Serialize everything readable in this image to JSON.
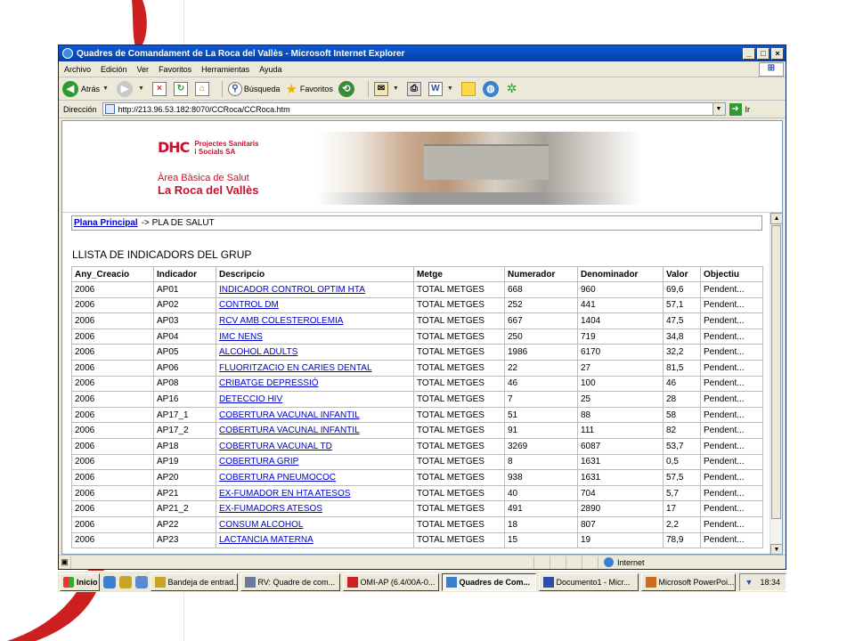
{
  "window": {
    "title": "Quadres de Comandament de La Roca del Vallès - Microsoft Internet Explorer",
    "buttons": {
      "minimize": "_",
      "maximize": "□",
      "close": "×"
    }
  },
  "menu": [
    "Archivo",
    "Edición",
    "Ver",
    "Favoritos",
    "Herramientas",
    "Ayuda"
  ],
  "toolbar": {
    "back": "Atrás",
    "search": "Búsqueda",
    "favorites": "Favoritos"
  },
  "address": {
    "label": "Dirección",
    "url": "http://213.96.53.182:8070/CCRoca/CCRoca.htm",
    "go": "Ir"
  },
  "banner": {
    "logo_mark": "DHC",
    "logo_line1": "Projectes Sanitaris",
    "logo_line2": "i Socials SA",
    "area_line1": "Àrea Bàsica de Salut",
    "area_line2": "La Roca del Vallès"
  },
  "breadcrumb": {
    "link": "Plana Principal",
    "rest": "-> PLA DE SALUT"
  },
  "list_title": "LLISTA DE INDICADORS DEL GRUP",
  "table": {
    "headers": [
      "Any_Creacio",
      "Indicador",
      "Descripcio",
      "Metge",
      "Numerador",
      "Denominador",
      "Valor",
      "Objectiu"
    ],
    "rows": [
      [
        "2006",
        "AP01",
        "INDICADOR CONTROL OPTIM HTA",
        "TOTAL METGES",
        "668",
        "960",
        "69,6",
        "Pendent..."
      ],
      [
        "2006",
        "AP02",
        "CONTROL DM",
        "TOTAL METGES",
        "252",
        "441",
        "57,1",
        "Pendent..."
      ],
      [
        "2006",
        "AP03",
        "RCV AMB COLESTEROLEMIA",
        "TOTAL METGES",
        "667",
        "1404",
        "47,5",
        "Pendent..."
      ],
      [
        "2006",
        "AP04",
        "IMC NENS",
        "TOTAL METGES",
        "250",
        "719",
        "34,8",
        "Pendent..."
      ],
      [
        "2006",
        "AP05",
        "ALCOHOL ADULTS",
        "TOTAL METGES",
        "1986",
        "6170",
        "32,2",
        "Pendent..."
      ],
      [
        "2006",
        "AP06",
        "FLUORITZACIO EN CARIES DENTAL",
        "TOTAL METGES",
        "22",
        "27",
        "81,5",
        "Pendent..."
      ],
      [
        "2006",
        "AP08",
        "CRIBATGE DEPRESSIÓ",
        "TOTAL METGES",
        "46",
        "100",
        "46",
        "Pendent..."
      ],
      [
        "2006",
        "AP16",
        "DETECCIO HIV",
        "TOTAL METGES",
        "7",
        "25",
        "28",
        "Pendent..."
      ],
      [
        "2006",
        "AP17_1",
        "COBERTURA VACUNAL INFANTIL",
        "TOTAL METGES",
        "51",
        "88",
        "58",
        "Pendent..."
      ],
      [
        "2006",
        "AP17_2",
        "COBERTURA VACUNAL INFANTIL",
        "TOTAL METGES",
        "91",
        "111",
        "82",
        "Pendent..."
      ],
      [
        "2006",
        "AP18",
        "COBERTURA VACUNAL TD",
        "TOTAL METGES",
        "3269",
        "6087",
        "53,7",
        "Pendent..."
      ],
      [
        "2006",
        "AP19",
        "COBERTURA GRIP",
        "TOTAL METGES",
        "8",
        "1631",
        "0,5",
        "Pendent..."
      ],
      [
        "2006",
        "AP20",
        "COBERTURA PNEUMOCOC",
        "TOTAL METGES",
        "938",
        "1631",
        "57,5",
        "Pendent..."
      ],
      [
        "2006",
        "AP21",
        "EX-FUMADOR EN HTA ATESOS",
        "TOTAL METGES",
        "40",
        "704",
        "5,7",
        "Pendent..."
      ],
      [
        "2006",
        "AP21_2",
        "EX-FUMADORS ATESOS",
        "TOTAL METGES",
        "491",
        "2890",
        "17",
        "Pendent..."
      ],
      [
        "2006",
        "AP22",
        "CONSUM ALCOHOL",
        "TOTAL METGES",
        "18",
        "807",
        "2,2",
        "Pendent..."
      ],
      [
        "2006",
        "AP23",
        "LACTANCIA MATERNA",
        "TOTAL METGES",
        "15",
        "19",
        "78,9",
        "Pendent..."
      ]
    ]
  },
  "status": {
    "zone": "Internet"
  },
  "taskbar": {
    "start": "Inicio",
    "tasks": [
      {
        "label": "Bandeja de entrad...",
        "color": "#c9a227",
        "active": false
      },
      {
        "label": "RV: Quadre de com...",
        "color": "#6a7a9a",
        "active": false
      },
      {
        "label": "OMI-AP (6.4/00A-0...",
        "color": "#cc2222",
        "active": false
      },
      {
        "label": "Quadres de Com...",
        "color": "#3a7fd0",
        "active": true
      },
      {
        "label": "Documento1 - Micr...",
        "color": "#2b4fa8",
        "active": false
      },
      {
        "label": "Microsoft PowerPoi...",
        "color": "#d2691e",
        "active": false
      }
    ],
    "clock": "18:34"
  },
  "colors": {
    "accent": "#c8102e",
    "link": "#0000cc",
    "titlebar": "#0a5ad6"
  }
}
